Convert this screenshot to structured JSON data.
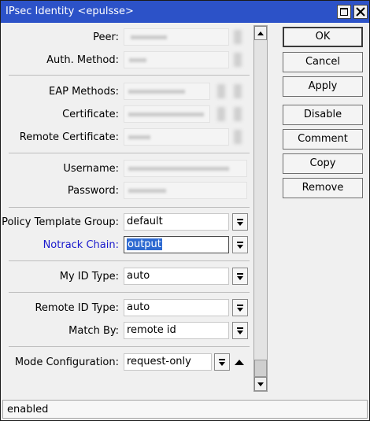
{
  "window": {
    "title": "IPsec Identity <epulsse>"
  },
  "form": {
    "peer": {
      "label": "Peer:"
    },
    "auth_method": {
      "label": "Auth. Method:"
    },
    "eap_methods": {
      "label": "EAP Methods:"
    },
    "certificate": {
      "label": "Certificate:"
    },
    "remote_certificate": {
      "label": "Remote Certificate:"
    },
    "username": {
      "label": "Username:"
    },
    "password": {
      "label": "Password:"
    },
    "policy_template_group": {
      "label": "Policy Template Group:",
      "value": "default"
    },
    "notrack_chain": {
      "label": "Notrack Chain:",
      "value": "output"
    },
    "my_id_type": {
      "label": "My ID Type:",
      "value": "auto"
    },
    "remote_id_type": {
      "label": "Remote ID Type:",
      "value": "auto"
    },
    "match_by": {
      "label": "Match By:",
      "value": "remote id"
    },
    "mode_configuration": {
      "label": "Mode Configuration:",
      "value": "request-only"
    }
  },
  "buttons": {
    "ok": "OK",
    "cancel": "Cancel",
    "apply": "Apply",
    "disable": "Disable",
    "comment": "Comment",
    "copy": "Copy",
    "remove": "Remove"
  },
  "status": {
    "text": "enabled"
  },
  "colors": {
    "titlebar": "#2c52c8",
    "selection": "#2e6ad1",
    "notrack_label": "#1a1acc"
  }
}
